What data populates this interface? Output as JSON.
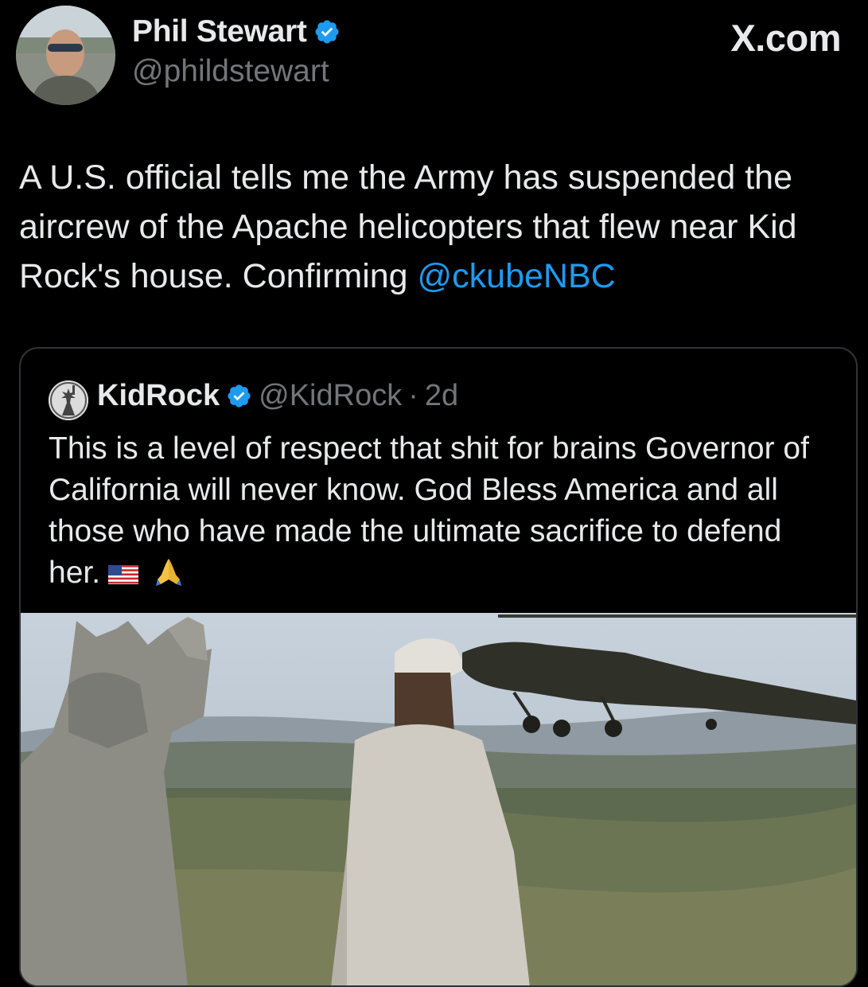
{
  "post": {
    "author_name": "Phil Stewart",
    "author_handle": "@phildstewart",
    "brand": "X.com",
    "text_prefix": "A U.S. official tells me the Army has suspended the aircrew of the Apache helicopters that flew near Kid Rock's house. Confirming ",
    "mention": "@ckubeNBC"
  },
  "quote": {
    "author_name": "KidRock",
    "author_handle": "@KidRock",
    "separator": "·",
    "timestamp": "2d",
    "text": "This is a level of respect that shit for brains Governor of California will never know. God Bless America and all those who have made the ultimate sacrifice to defend her.",
    "emojis": [
      "us-flag",
      "folded-hands"
    ]
  },
  "colors": {
    "background": "#000000",
    "text": "#e7e9ea",
    "secondary_text": "#71767b",
    "link": "#1d9bf0",
    "verified": "#1d9bf0",
    "border": "#2f3336"
  }
}
